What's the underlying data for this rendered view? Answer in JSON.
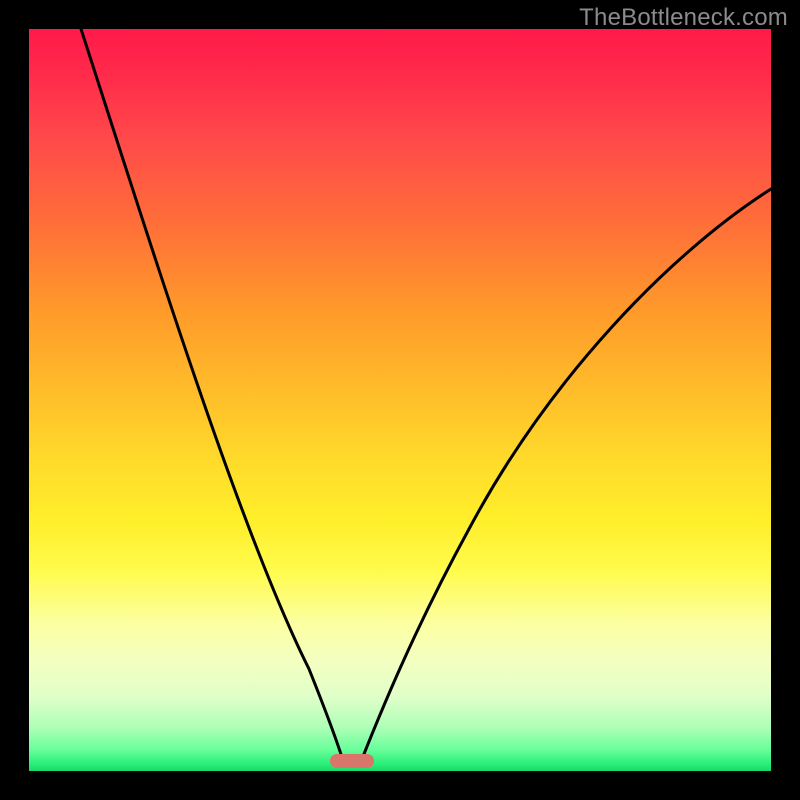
{
  "watermark": {
    "text": "TheBottleneck.com"
  },
  "chart_data": {
    "type": "line",
    "title": "",
    "xlabel": "",
    "ylabel": "",
    "xlim": [
      0,
      100
    ],
    "ylim": [
      0,
      100
    ],
    "marker": {
      "x_frac": 0.413,
      "y_frac": 0.987,
      "width_frac": 0.059,
      "height_frac": 0.019
    },
    "series": [
      {
        "name": "left-curve",
        "x": [
          7,
          10,
          14,
          18,
          22,
          26,
          30,
          33,
          36,
          38,
          40,
          41.6,
          42.4
        ],
        "y": [
          100,
          92,
          81,
          70,
          59,
          48,
          36,
          27,
          18,
          12,
          6,
          2,
          0
        ]
      },
      {
        "name": "right-curve",
        "x": [
          44.6,
          46,
          48,
          51,
          55,
          60,
          66,
          73,
          81,
          90,
          100
        ],
        "y": [
          0,
          4,
          10,
          18,
          28,
          38,
          48,
          57,
          65,
          72,
          78
        ]
      }
    ],
    "gradient_stops": [
      {
        "pos": 0,
        "color": "#ff1a49"
      },
      {
        "pos": 50,
        "color": "#ffc72a"
      },
      {
        "pos": 80,
        "color": "#fdffa0"
      },
      {
        "pos": 100,
        "color": "#19d868"
      }
    ]
  }
}
